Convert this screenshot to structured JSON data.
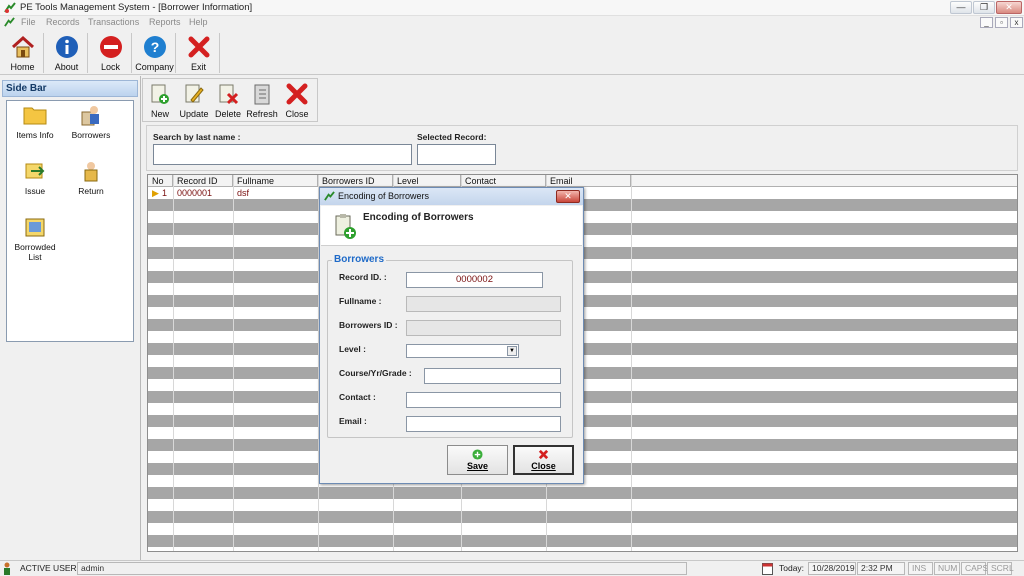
{
  "window": {
    "title": "PE Tools Management System - [Borrower Information]"
  },
  "window_buttons": {
    "minimize": "—",
    "restore": "❐",
    "close": "✕",
    "mdi_minimize": "_",
    "mdi_restore": "▫",
    "mdi_close": "x"
  },
  "menubar": {
    "items": [
      "File",
      "Records",
      "Transactions",
      "Reports",
      "Help"
    ]
  },
  "toolbar": {
    "items": [
      "Home",
      "About",
      "Lock",
      "Company",
      "Exit"
    ]
  },
  "sidebar": {
    "title": "Side Bar",
    "items": [
      "Items Info",
      "Borrowers",
      "Issue",
      "Return",
      "Borrowded List"
    ]
  },
  "subtoolbar": {
    "items": [
      "New",
      "Update",
      "Delete",
      "Refresh",
      "Close"
    ]
  },
  "search": {
    "label": "Search by last name :",
    "value": "",
    "selected_label": "Selected Record:",
    "selected_value": ""
  },
  "grid": {
    "columns": [
      "No",
      "Record ID",
      "Fullname",
      "Borrowers ID",
      "Level",
      "Contact",
      "Email"
    ],
    "rows": [
      {
        "no": "1",
        "record_id": "0000001",
        "fullname": "dsf"
      }
    ]
  },
  "dialog": {
    "title": "Encoding of Borrowers",
    "heading": "Encoding of Borrowers",
    "group": "Borrowers",
    "fields": {
      "record_id_label": "Record ID. :",
      "record_id_value": "0000002",
      "fullname_label": "Fullname :",
      "borrowers_id_label": "Borrowers ID :",
      "level_label": "Level :",
      "level_value": "",
      "course_label": "Course/Yr/Grade :",
      "contact_label": "Contact :",
      "email_label": "Email :"
    },
    "save_label": "Save",
    "close_label": "Close"
  },
  "status": {
    "active_user_label": "ACTIVE USER:",
    "active_user": "admin",
    "today_label": "Today:",
    "date": "10/28/2019",
    "time": "2:32 PM",
    "ins": "INS",
    "num": "NUM",
    "caps": "CAPS",
    "scrl": "SCRL"
  },
  "colors": {
    "accent": "#1e6ac8",
    "grid_band": "#a6a6a6",
    "row_text": "#7a1010"
  }
}
